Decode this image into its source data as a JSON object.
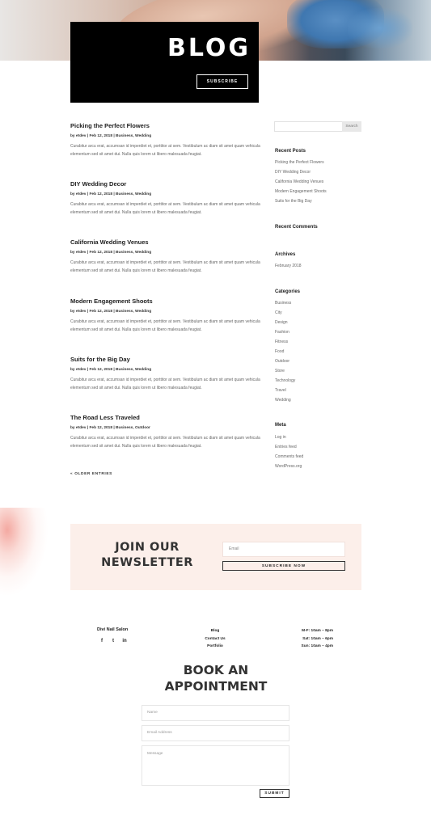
{
  "hero": {
    "title": "BLOG",
    "subscribe_label": "SUBSCRIBE"
  },
  "posts": [
    {
      "title": "Picking the Perfect Flowers",
      "meta": "by etdev | Feb 12, 2018 | Business, Wedding",
      "excerpt": "Curabitur arcu erat, accumsan id imperdiet et, porttitor at sem. Vestibulum ac diam sit amet quam vehicula elementum sed sit amet dui. Nulla quis lorem ut libero malesuada feugiat."
    },
    {
      "title": "DIY Wedding Decor",
      "meta": "by etdev | Feb 12, 2018 | Business, Wedding",
      "excerpt": "Curabitur arcu erat, accumsan id imperdiet et, porttitor at sem. Vestibulum ac diam sit amet quam vehicula elementum sed sit amet dui. Nulla quis lorem ut libero malesuada feugiat."
    },
    {
      "title": "California Wedding Venues",
      "meta": "by etdev | Feb 12, 2018 | Business, Wedding",
      "excerpt": "Curabitur arcu erat, accumsan id imperdiet et, porttitor at sem. Vestibulum ac diam sit amet quam vehicula elementum sed sit amet dui. Nulla quis lorem ut libero malesuada feugiat."
    },
    {
      "title": "Modern Engagement Shoots",
      "meta": "by etdev | Feb 12, 2018 | Business, Wedding",
      "excerpt": "Curabitur arcu erat, accumsan id imperdiet et, porttitor at sem. Vestibulum ac diam sit amet quam vehicula elementum sed sit amet dui. Nulla quis lorem ut libero malesuada feugiat."
    },
    {
      "title": "Suits for the Big Day",
      "meta": "by etdev | Feb 12, 2018 | Business, Wedding",
      "excerpt": "Curabitur arcu erat, accumsan id imperdiet et, porttitor at sem. Vestibulum ac diam sit amet quam vehicula elementum sed sit amet dui. Nulla quis lorem ut libero malesuada feugiat."
    },
    {
      "title": "The Road Less Traveled",
      "meta": "by etdev | Feb 12, 2018 | Business, Outdoor",
      "excerpt": "Curabitur arcu erat, accumsan id imperdiet et, porttitor at sem. Vestibulum ac diam sit amet quam vehicula elementum sed sit amet dui. Nulla quis lorem ut libero malesuada feugiat."
    }
  ],
  "older_entries": "« OLDER ENTRIES",
  "sidebar": {
    "search_button": "Search",
    "recent_posts_title": "Recent Posts",
    "recent_posts": [
      "Picking the Perfect Flowers",
      "DIY Wedding Decor",
      "California Wedding Venues",
      "Modern Engagement Shoots",
      "Suits for the Big Day"
    ],
    "recent_comments_title": "Recent Comments",
    "archives_title": "Archives",
    "archives": [
      "February 2018"
    ],
    "categories_title": "Categories",
    "categories": [
      "Business",
      "City",
      "Design",
      "Fashion",
      "Fitness",
      "Food",
      "Outdoor",
      "Store",
      "Technology",
      "Travel",
      "Wedding"
    ],
    "meta_title": "Meta",
    "meta": [
      "Log in",
      "Entries feed",
      "Comments feed",
      "WordPress.org"
    ]
  },
  "newsletter": {
    "title_line1": "JOIN OUR",
    "title_line2": "NEWSLETTER",
    "email_placeholder": "Email",
    "subscribe_label": "SUBSCRIBE NOW"
  },
  "footer": {
    "salon_name": "Divi Nail Salon",
    "social_icons": [
      "facebook-icon",
      "twitter-icon",
      "linkedin-icon"
    ],
    "social_glyphs": [
      "f",
      "t",
      "in"
    ],
    "links": [
      "Blog",
      "Contact Us",
      "Portfolio"
    ],
    "hours": [
      "M-F: 10am – 8pm",
      "Sat: 10am – 6pm",
      "Sun: 10am – 4pm"
    ]
  },
  "appointment": {
    "title_line1": "BOOK AN",
    "title_line2": "APPOINTMENT",
    "name_placeholder": "Name",
    "email_placeholder": "Email Address",
    "message_placeholder": "Message",
    "submit_label": "SUBMIT"
  },
  "colors": {
    "newsletter_bg": "#fcefea",
    "hero_card": "#000000",
    "text_dark": "#222222"
  }
}
